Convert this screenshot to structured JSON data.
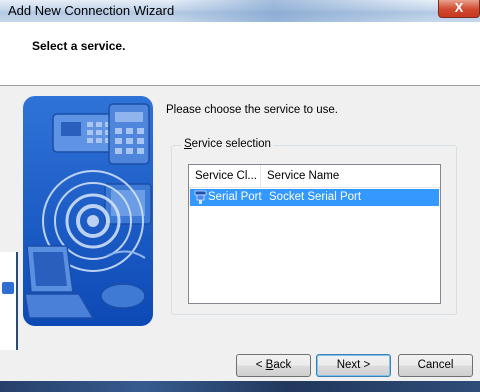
{
  "window": {
    "title": "Add New Connection Wizard",
    "close_glyph": "X"
  },
  "header": {
    "heading": "Select a service."
  },
  "prompt": "Please choose the service to use.",
  "group": {
    "label_prefix": "",
    "label_mnemonic": "S",
    "label_rest": "ervice selection"
  },
  "listview": {
    "columns": [
      "Service Cl...",
      "Service Name"
    ],
    "rows": [
      {
        "class": "Serial Port",
        "name": "Socket Serial Port",
        "icon": "serial-port-icon",
        "selected": true
      }
    ]
  },
  "buttons": {
    "back_prefix": "< ",
    "back_mnemonic": "B",
    "back_rest": "ack",
    "next": "Next >",
    "cancel": "Cancel"
  },
  "colors": {
    "selection": "#3399ff",
    "art_blue": "#1a5cc8",
    "close_red": "#d0482f"
  }
}
